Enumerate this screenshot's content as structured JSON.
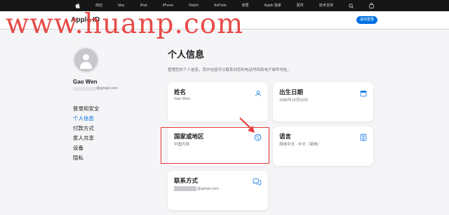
{
  "watermark": "www.huanp.com",
  "globalnav": {
    "items": [
      "商店",
      "Mac",
      "iPad",
      "iPhone",
      "Watch",
      "AirPods",
      "家居",
      "Apple 独家",
      "配件",
      "技术支持"
    ],
    "icons": [
      "apple-logo",
      "search-icon",
      "bag-icon"
    ]
  },
  "subnav": {
    "title": "Apple ID",
    "signout_label": "退出登录"
  },
  "user": {
    "name": "Gao Wen",
    "email_suffix": "@gmail.com"
  },
  "sidebar": {
    "items": [
      {
        "label": "登录和安全",
        "active": false
      },
      {
        "label": "个人信息",
        "active": true
      },
      {
        "label": "付款方式",
        "active": false
      },
      {
        "label": "家人共享",
        "active": false
      },
      {
        "label": "设备",
        "active": false
      },
      {
        "label": "隐私",
        "active": false
      }
    ]
  },
  "section": {
    "title": "个人信息",
    "description": "管理您的个人信息，其中包括可以联系到您的电话号码和电子邮件地址。"
  },
  "cards": {
    "name": {
      "title": "姓名",
      "value": "Gao Wen",
      "icon": "person-icon"
    },
    "birthday": {
      "title": "出生日期",
      "value": "1990年10月10日",
      "icon": "calendar-icon"
    },
    "region": {
      "title": "国家或地区",
      "value": "中国大陆",
      "icon": "globe-icon"
    },
    "language": {
      "title": "语言",
      "value": "简体中文 - 中文（简体）",
      "icon": "book-icon"
    },
    "contact": {
      "title": "联系方式",
      "value_suffix": "@gmail.com",
      "icon": "chat-bubbles-icon"
    }
  },
  "colors": {
    "accent": "#0071e3",
    "annotation": "#e53935",
    "nav_bg": "#161617"
  }
}
